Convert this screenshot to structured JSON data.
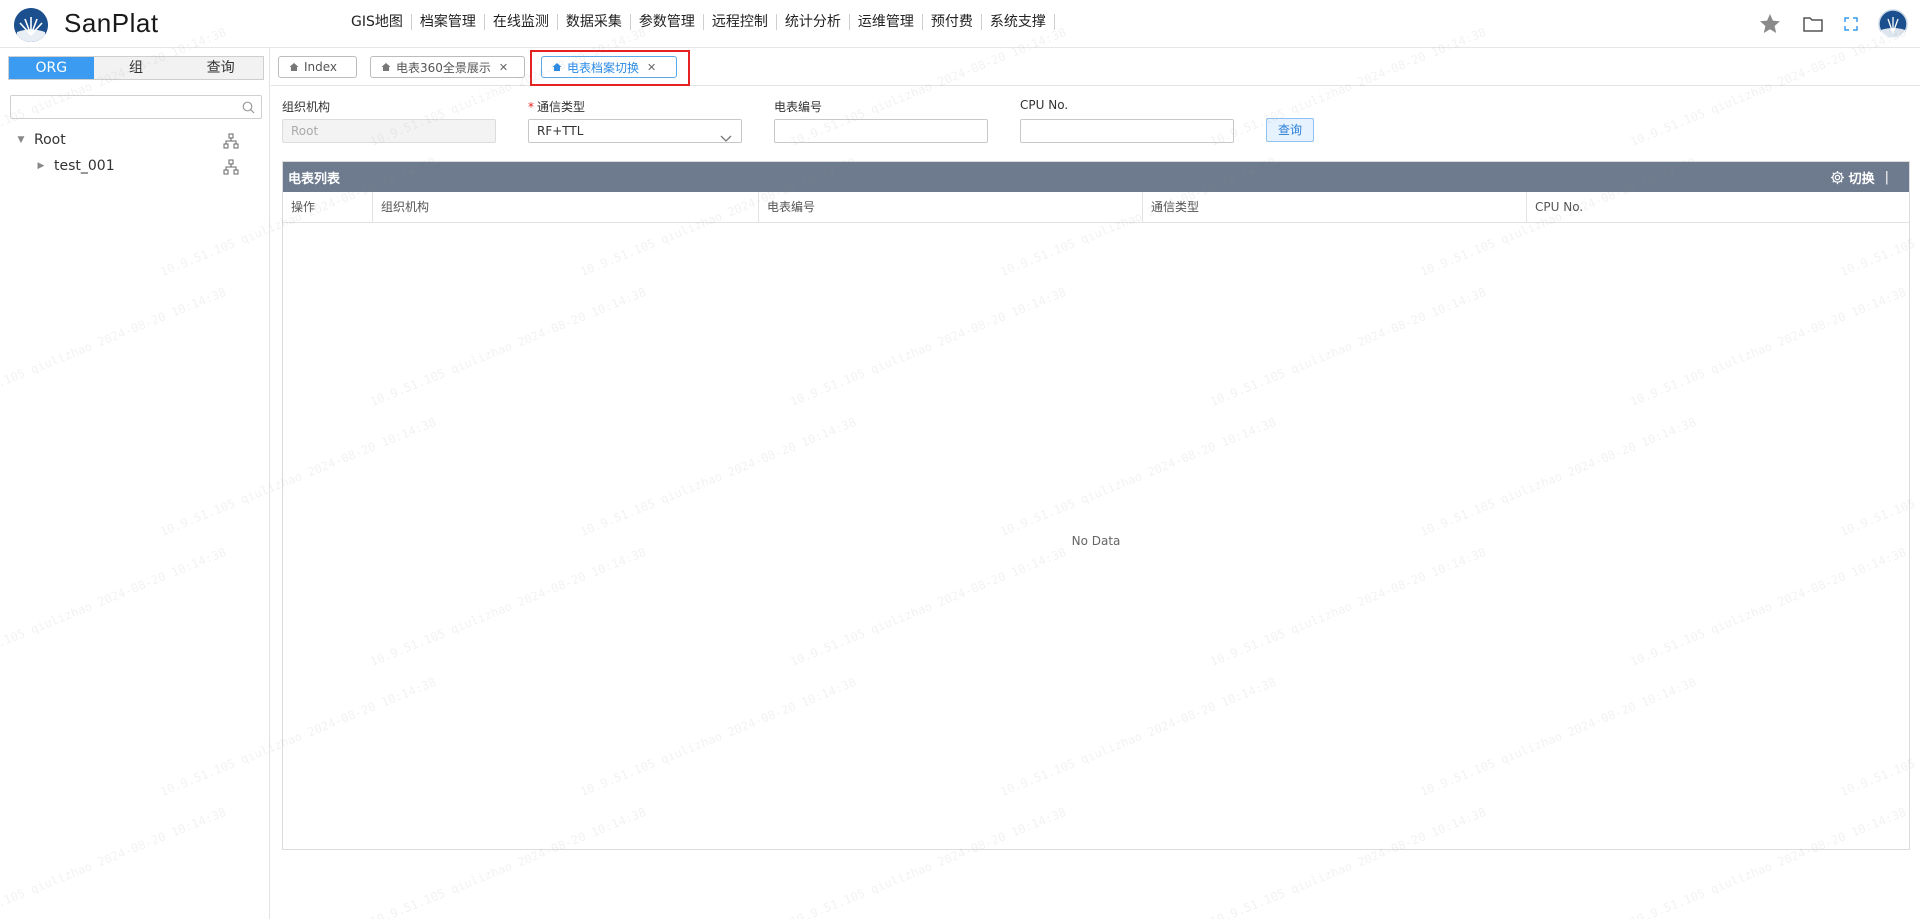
{
  "app": {
    "name": "SanPlat"
  },
  "nav": [
    "GIS地图",
    "档案管理",
    "在线监测",
    "数据采集",
    "参数管理",
    "远程控制",
    "统计分析",
    "运维管理",
    "预付费",
    "系统支撑"
  ],
  "header_icons": [
    "star-icon",
    "folder-icon",
    "fullscreen-icon",
    "user-avatar"
  ],
  "sidebar": {
    "tabs": [
      "ORG",
      "组",
      "查询"
    ],
    "active_tab": "ORG",
    "search": {
      "value": "",
      "placeholder": ""
    },
    "tree": [
      {
        "label": "Root",
        "expanded": true
      },
      {
        "label": "test_001",
        "expanded": false
      }
    ]
  },
  "page_tabs": [
    {
      "label": "Index",
      "closable": false,
      "active": false
    },
    {
      "label": "电表360全景展示",
      "closable": true,
      "active": false
    },
    {
      "label": "电表档案切换",
      "closable": true,
      "active": true
    }
  ],
  "filter": {
    "org_label": "组织机构",
    "org_value": "Root",
    "comm_label": "通信类型",
    "comm_value": "RF+TTL",
    "meter_label": "电表编号",
    "meter_value": "",
    "cpu_label": "CPU No.",
    "cpu_value": "",
    "query_button": "查询"
  },
  "table": {
    "title": "电表列表",
    "switch_label": "切换",
    "separator": "|",
    "columns": [
      "操作",
      "组织机构",
      "电表编号",
      "通信类型",
      "CPU No."
    ],
    "rows": [],
    "empty_text": "No Data"
  },
  "watermark": "10.9.51.105  qiulizhao  2024-08-20  10:14:38",
  "colors": {
    "accent": "#3a9bf0",
    "panel_header": "#6e7b8f",
    "highlight": "#e52222",
    "logo": "#1b4f8e"
  }
}
